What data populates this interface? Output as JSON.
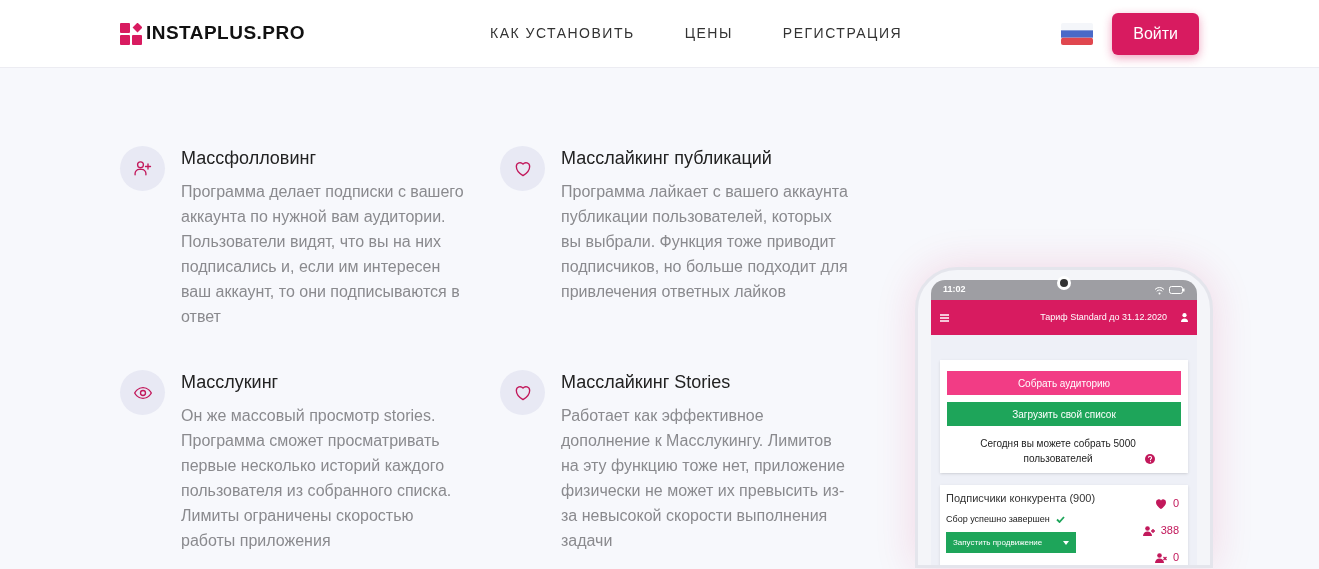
{
  "header": {
    "logo": "INSTAPLUS.PRO",
    "nav": [
      "КАК УСТАНОВИТЬ",
      "ЦЕНЫ",
      "РЕГИСТРАЦИЯ"
    ],
    "login_button": "Войти"
  },
  "features": [
    {
      "kind": "follow",
      "title": "Массфолловинг",
      "text": "Программа делает подписки с вашего аккаунта по нужной вам аудитории. Пользователи видят, что вы на них подписались и, если им интересен ваш аккаунт, то они подписываются в ответ"
    },
    {
      "kind": "like",
      "title": "Масслайкинг публикаций",
      "text": "Программа лайкает с вашего аккаунта публикации пользователей, которых вы выбрали. Функция тоже приводит подписчиков, но больше подходит для привлечения ответных лайков"
    },
    {
      "kind": "view",
      "title": "Масслукинг",
      "text": "Он же массовый просмотр stories. Программа сможет просматривать первые несколько историй каждого пользователя из собранного списка. Лимиты ограничены скоростью работы приложения"
    },
    {
      "kind": "like",
      "title": "Масслайкинг Stories",
      "text": "Работает как эффективное дополнение к Масслукингу. Лимитов на эту функцию тоже нет, приложение физически не может их превысить из-за невысокой скорости выполнения задачи"
    }
  ],
  "phone": {
    "time": "11:02",
    "plan": "Тариф Standard до 31.12.2020",
    "collect_button": "Собрать аудиторию",
    "upload_button": "Загрузить свой список",
    "today_text": "Сегодня вы можете собрать 5000 пользователей",
    "task": {
      "title": "Подписчики конкурента (900)",
      "status": "Сбор успешно завершен",
      "action_button": "Запустить продвижение",
      "stats": [
        {
          "kind": "likes",
          "value": "0"
        },
        {
          "kind": "follows",
          "value": "388"
        },
        {
          "kind": "unfollows",
          "value": "0"
        }
      ]
    }
  }
}
